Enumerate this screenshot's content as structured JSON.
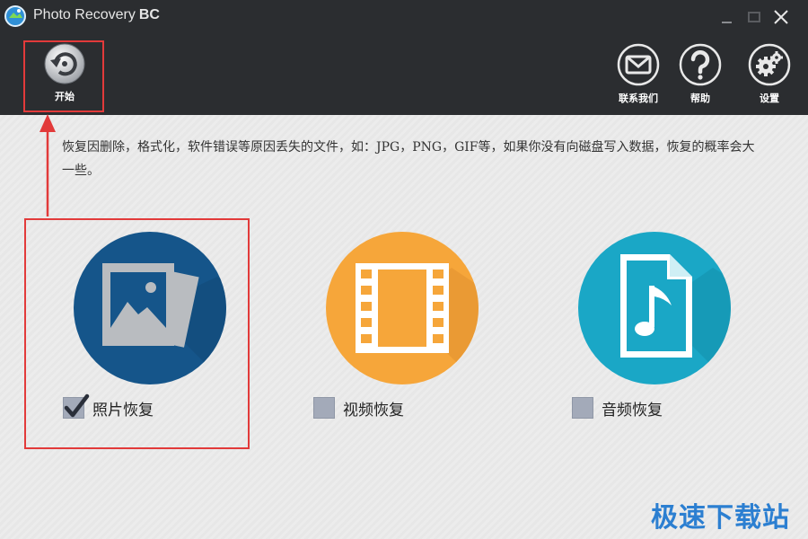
{
  "window": {
    "title": "Photo Recovery",
    "title_suffix": "BC"
  },
  "toolbar": {
    "start_label": "开始",
    "contact_label": "联系我们",
    "help_label": "帮助",
    "settings_label": "设置"
  },
  "description": "恢复因删除，格式化，软件错误等原因丢失的文件，如：JPG，PNG，GIF等，如果你没有向磁盘写入数据，恢复的概率会大一些。",
  "options": [
    {
      "label": "照片恢复",
      "checked": true,
      "icon": "photo-icon",
      "color": "#15558a"
    },
    {
      "label": "视频恢复",
      "checked": false,
      "icon": "film-icon",
      "color": "#f6a63a"
    },
    {
      "label": "音频恢复",
      "checked": false,
      "icon": "music-file-icon",
      "color": "#1aa7c6"
    }
  ],
  "highlight_color": "#e23a3a",
  "watermark": "极速下载站"
}
